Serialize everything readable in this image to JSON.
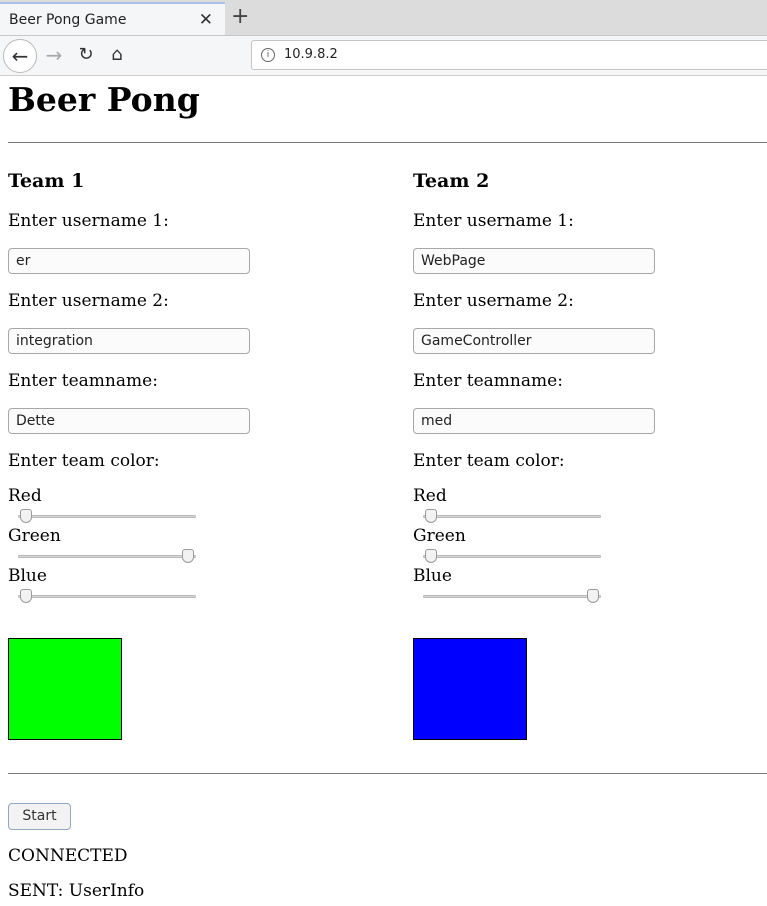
{
  "browser": {
    "tab_title": "Beer Pong Game",
    "close_glyph": "✕",
    "new_tab_glyph": "+",
    "url": "10.9.8.2",
    "info_glyph": "i"
  },
  "page": {
    "title": "Beer Pong",
    "start_label": "Start",
    "status_connection": "CONNECTED",
    "status_sent": "SENT: UserInfo"
  },
  "teams": [
    {
      "heading": "Team 1",
      "username1_label": "Enter username 1:",
      "username1_value": "er",
      "username2_label": "Enter username 2:",
      "username2_value": "integration",
      "teamname_label": "Enter teamname:",
      "teamname_value": "Dette",
      "color_label": "Enter team color:",
      "red_label": "Red",
      "green_label": "Green",
      "blue_label": "Blue",
      "red_level": 0,
      "green_level": 1,
      "blue_level": 0,
      "swatch_color": "#00ff00"
    },
    {
      "heading": "Team 2",
      "username1_label": "Enter username 1:",
      "username1_value": "WebPage",
      "username2_label": "Enter username 2:",
      "username2_value": "GameController",
      "teamname_label": "Enter teamname:",
      "teamname_value": "med",
      "color_label": "Enter team color:",
      "red_label": "Red",
      "green_label": "Green",
      "blue_label": "Blue",
      "red_level": 0,
      "green_level": 0,
      "blue_level": 1,
      "swatch_color": "#0000ff"
    }
  ]
}
